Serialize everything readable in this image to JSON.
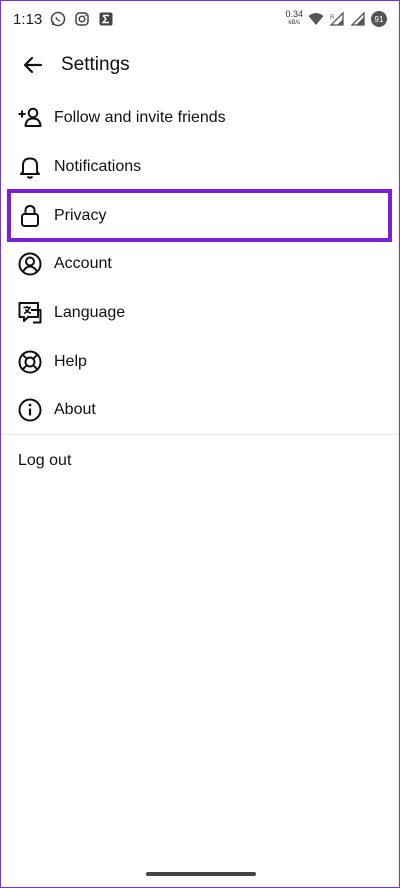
{
  "status_bar": {
    "time": "1:13",
    "net_speed_value": "0.34",
    "net_speed_unit": "kB/s",
    "battery": "91",
    "icons": [
      "whatsapp-icon",
      "instagram-icon",
      "sigma-app-icon",
      "wifi-icon",
      "signal-icon",
      "signal-icon",
      "battery-icon"
    ]
  },
  "header": {
    "title": "Settings",
    "back_icon": "arrow-left-icon"
  },
  "menu": {
    "items": [
      {
        "label": "Follow and invite friends",
        "icon": "add-person-icon"
      },
      {
        "label": "Notifications",
        "icon": "bell-icon"
      },
      {
        "label": "Privacy",
        "icon": "lock-icon",
        "highlighted": true
      },
      {
        "label": "Account",
        "icon": "account-circle-icon"
      },
      {
        "label": "Language",
        "icon": "translate-icon"
      },
      {
        "label": "Help",
        "icon": "lifebuoy-icon"
      },
      {
        "label": "About",
        "icon": "info-icon"
      }
    ]
  },
  "logout_label": "Log out",
  "colors": {
    "highlight": "#7b1fd8",
    "text": "#111111",
    "background": "#ffffff"
  }
}
